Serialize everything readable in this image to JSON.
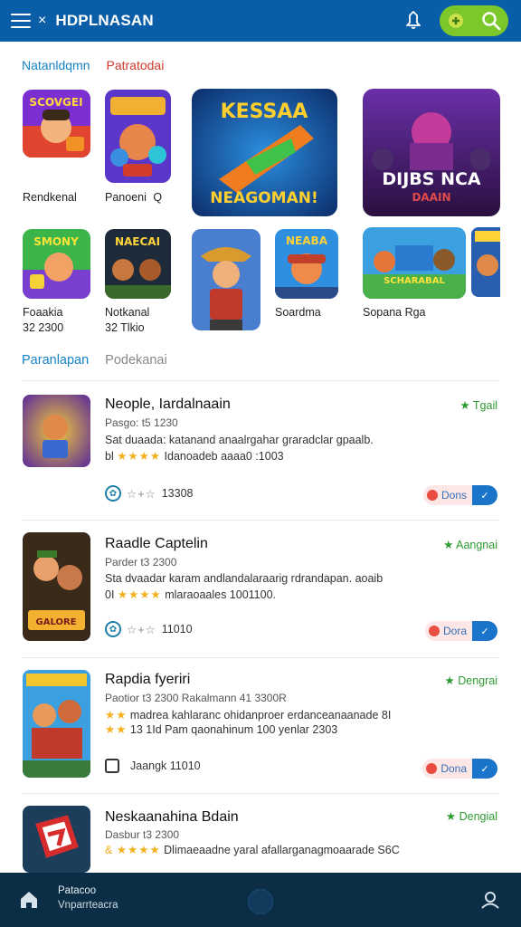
{
  "header": {
    "title": "HDPLNASAN",
    "close_glyph": "×"
  },
  "top_tabs": {
    "first": "Natanldqmn",
    "second": "Patratodai"
  },
  "featured": [
    {
      "label": "Rendkenal",
      "icon": "game-tile-scovger",
      "art_text": "SCOVGEI"
    },
    {
      "label": "Panoeni",
      "icon": "game-tile-hero-team",
      "art_text": "",
      "badge": "Q"
    },
    {
      "label": "",
      "icon": "game-banner-kessaa",
      "art_text_top": "KESSAA",
      "art_text_bottom": "NEAGOMAN!"
    },
    {
      "label": "",
      "icon": "game-banner-dijbs-nca",
      "art_text_top": "DIJBS NCA",
      "art_text_bottom": "DAAIN"
    }
  ],
  "second_row": [
    {
      "label": "Foaakia",
      "sub": "32 2300",
      "icon": "game-tile-smony",
      "art_text": "SMONY"
    },
    {
      "label": "Notkanal",
      "sub": "32 Tlkio",
      "icon": "game-tile-naecal",
      "art_text": "NAECAI"
    },
    {
      "label": "",
      "icon": "game-tile-cowboy",
      "art_text": ""
    },
    {
      "label": "Soardma",
      "icon": "game-tile-neaba",
      "art_text": "NEABA"
    },
    {
      "label": "Sopana Rga",
      "icon": "game-tile-scharabal",
      "art_text": "SCHARABAL"
    },
    {
      "label": "",
      "icon": "game-tile-partial",
      "art_text": ""
    }
  ],
  "list_tabs": {
    "first": "Paranlapan",
    "second": "Podekanai"
  },
  "list": [
    {
      "title": "Neople, Iardalnaain",
      "sub": "Pasgo: t5 1230",
      "desc1": "Sat duaada: katanand anaalrgahar graradclar gpaalb.",
      "desc2_prefix": "bl",
      "stars": "★★★★",
      "desc2": "Idanoadeb aaaa0 :1003",
      "tag": "★ Tgail",
      "meta_icon": "paw-icon",
      "meta_stars": "☆+☆",
      "meta_count": "13308",
      "button_label": "Dons",
      "button_icon": "✓"
    },
    {
      "title": "Raadle Captelin",
      "sub": "Parder t3 2300",
      "desc1": "Sta dvaadar karam andlandalaraarig rdrandapan. aoaib",
      "desc2_prefix": "0I",
      "stars": "★★★★",
      "desc2": "mlaraoaales 1001100.",
      "tag": "★ Aangnai",
      "meta_icon": "paw-icon",
      "meta_stars": "☆+☆",
      "meta_count": "11010",
      "button_label": "Dora",
      "button_icon": "✓"
    },
    {
      "title": "Rapdia fyeriri",
      "sub": "Paotior t3 2300  Rakalmann 41 3300R",
      "desc1_prefix": "★★",
      "desc1": "madrea kahlaranc ohidanproer erdanceanaanade 8I",
      "desc2_prefix": "★★",
      "stars": "",
      "desc2": "13 1Id Pam qaonahinum 100 yenlar 2303",
      "tag": "★ Dengrai",
      "meta_icon": "square-icon",
      "meta_stars": "",
      "meta_count": "Jaangk 11010",
      "button_label": "Dona",
      "button_icon": "✓"
    },
    {
      "title": "Neskaanahina Bdain",
      "sub": "Dasbur t3 2300",
      "desc1_prefix": "&",
      "stars": "★★★★",
      "desc1": "Dlimaeaadne yaral afallarganagmoaarade S6C",
      "tag": "★ Dengial"
    }
  ],
  "bottom_nav": {
    "line1": "Patacoo",
    "line2": "Vnparrteacra"
  },
  "colors": {
    "header": "#0a5ea8",
    "accent_green": "#7cc72a",
    "bottom": "#0b2d45",
    "star": "#f2b01e",
    "tag_green": "#2c9a2f"
  }
}
